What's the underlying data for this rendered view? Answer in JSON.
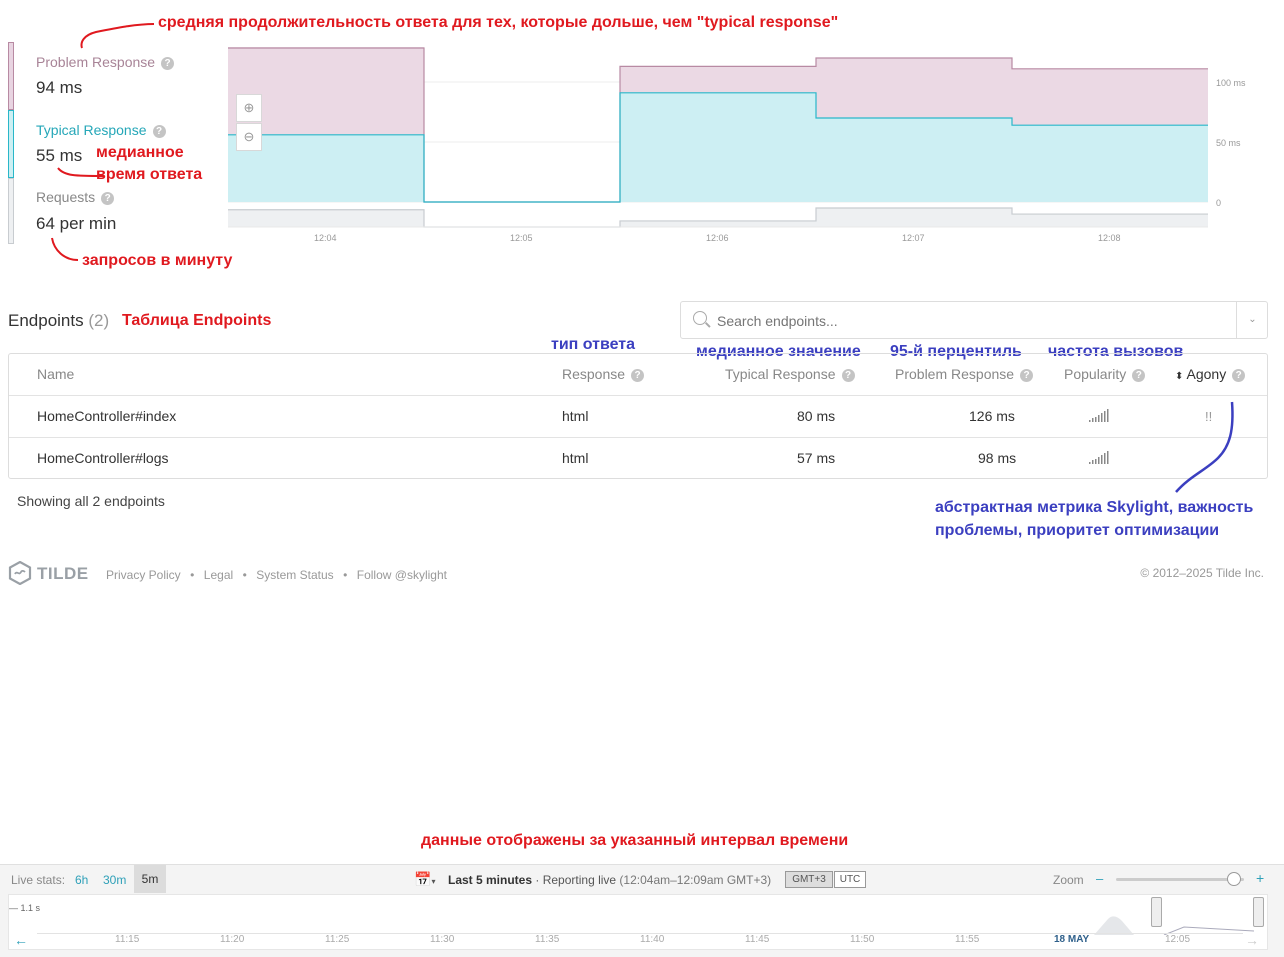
{
  "annotations": {
    "problem": "средняя продолжительность ответа для тех, которые дольше, чем \"typical response\"",
    "median_line1": "медианное",
    "median_line2": "время ответа",
    "rpm": "запросов в минуту",
    "endpoints_table": "Таблица Endpoints",
    "response_type": "тип ответа",
    "median_value": "медианное значение",
    "percentile": "95-й перцентиль",
    "frequency": "частота вызовов",
    "agony_line1": "абстрактная метрика Skylight, важность",
    "agony_line2": "проблемы, приоритет оптимизации",
    "interval": "данные отображены за указанный интервал времени"
  },
  "metrics": {
    "problem_label": "Problem Response",
    "problem_value": "94 ms",
    "typical_label": "Typical Response",
    "typical_value": "55 ms",
    "requests_label": "Requests",
    "requests_value": "64 per min",
    "colors": {
      "problem": "#b88aa3",
      "typical": "#29b7c9",
      "requests": "#d4d8dc"
    }
  },
  "chart": {
    "zoom_in_icon": "zoom-in-icon",
    "zoom_out_icon": "zoom-out-icon",
    "ytick_100": "100 ms",
    "ytick_50": "50 ms",
    "ytick_0": "0",
    "xticks": [
      "12:04",
      "12:05",
      "12:06",
      "12:07",
      "12:08"
    ]
  },
  "chart_data": {
    "type": "area",
    "x": [
      "12:04",
      "12:05",
      "12:06",
      "12:07",
      "12:08"
    ],
    "ylim": [
      0,
      110
    ],
    "series": [
      {
        "name": "Problem Response",
        "values": [
          129,
          0,
          113,
          120,
          111
        ]
      },
      {
        "name": "Typical Response",
        "values": [
          56,
          0,
          91,
          70,
          64
        ]
      },
      {
        "name": "Requests",
        "values": [
          20,
          0,
          7,
          22,
          15
        ]
      }
    ],
    "grid": true
  },
  "endpoints": {
    "title": "Endpoints",
    "count": "(2)",
    "search_placeholder": "Search endpoints...",
    "headers": {
      "name": "Name",
      "response": "Response",
      "typical": "Typical Response",
      "problem": "Problem Response",
      "popularity": "Popularity",
      "agony": "Agony"
    },
    "rows": [
      {
        "name": "HomeController#index",
        "response": "html",
        "typical": "80 ms",
        "problem": "126 ms",
        "agony": "!!"
      },
      {
        "name": "HomeController#logs",
        "response": "html",
        "typical": "57 ms",
        "problem": "98 ms",
        "agony": ""
      }
    ],
    "showing": "Showing all 2 endpoints"
  },
  "footer": {
    "logo": "TILDE",
    "links": [
      "Privacy Policy",
      "Legal",
      "System Status",
      "Follow @skylight"
    ],
    "copyright": "© 2012–2025 Tilde Inc."
  },
  "bottom": {
    "live_stats": "Live stats:",
    "ranges": [
      "6h",
      "30m",
      "5m"
    ],
    "active_range": "5m",
    "period": "Last 5 minutes",
    "reporting": "· Reporting live",
    "interval": "(12:04am–12:09am GMT+3)",
    "tz1": "GMT+3",
    "tz2": "UTC",
    "zoom_label": "Zoom",
    "zoom_minus": "–",
    "zoom_plus": "+",
    "zoom_level": 0.92,
    "max_label": "— 1.1 s",
    "timeline_ticks": [
      "11:15",
      "11:20",
      "11:25",
      "11:30",
      "11:35",
      "11:40",
      "11:45",
      "11:50",
      "11:55",
      "18 MAY",
      "12:05"
    ]
  }
}
